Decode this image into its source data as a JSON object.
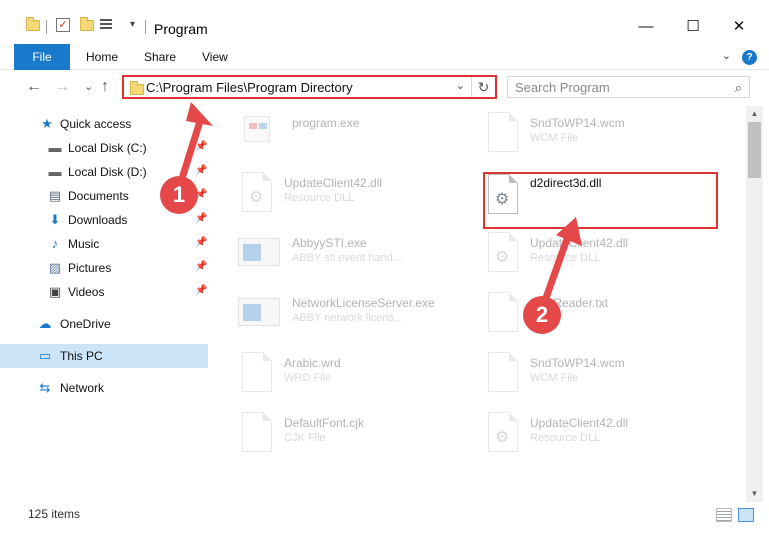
{
  "window": {
    "title": "Program",
    "minimize": "—",
    "maximize": "☐",
    "close": "✕"
  },
  "ribbon": {
    "tabs": [
      {
        "label": "File"
      },
      {
        "label": "Home"
      },
      {
        "label": "Share"
      },
      {
        "label": "View"
      }
    ],
    "help": "?",
    "collapse": "⌄"
  },
  "nav": {
    "back": "←",
    "forward": "→",
    "recent": "⌄",
    "up": "↑"
  },
  "address": {
    "path": "C:\\Program Files\\Program Directory",
    "dropdown": "⌄",
    "refresh": "↻"
  },
  "search": {
    "placeholder": "Search Program",
    "icon": "⌕"
  },
  "sidebar": {
    "items": [
      {
        "label": "Quick access",
        "icon": "★",
        "pinned": false
      },
      {
        "label": "Local Disk (C:)",
        "icon": "▬",
        "pinned": true
      },
      {
        "label": "Local Disk (D:)",
        "icon": "▬",
        "pinned": true
      },
      {
        "label": "Documents",
        "icon": "▤",
        "pinned": true
      },
      {
        "label": "Downloads",
        "icon": "⬇",
        "pinned": true
      },
      {
        "label": "Music",
        "icon": "♪",
        "pinned": true
      },
      {
        "label": "Pictures",
        "icon": "▨",
        "pinned": true
      },
      {
        "label": "Videos",
        "icon": "▣",
        "pinned": true
      },
      {
        "label": "OneDrive",
        "icon": "☁",
        "pinned": false
      },
      {
        "label": "This PC",
        "icon": "▭",
        "pinned": false
      },
      {
        "label": "Network",
        "icon": "⇆",
        "pinned": false
      }
    ]
  },
  "files": [
    {
      "name": "program.exe",
      "type": "",
      "icon": "exe-icon"
    },
    {
      "name": "SndToWP14.wcm",
      "type": "WCM File",
      "icon": "document-icon"
    },
    {
      "name": "UpdateClient42.dll",
      "type": "Resource DLL",
      "icon": "dll-gear-icon"
    },
    {
      "name": "d2direct3d.dll",
      "type": "",
      "icon": "dll-gear-icon"
    },
    {
      "name": "AbbyySTI.exe",
      "type": "ABBY sti event hand...",
      "icon": "window-app-icon"
    },
    {
      "name": "UpdateClient42.dll",
      "type": "Resource DLL",
      "icon": "dll-gear-icon"
    },
    {
      "name": "NetworkLicenseServer.exe",
      "type": "ABBY network licens...",
      "icon": "window-app-icon"
    },
    {
      "name": "FineReader.txt",
      "type": "File",
      "icon": "document-icon"
    },
    {
      "name": "Arabic.wrd",
      "type": "WRD File",
      "icon": "document-icon"
    },
    {
      "name": "SndToWP14.wcm",
      "type": "WCM File",
      "icon": "document-icon"
    },
    {
      "name": "DefaultFont.cjk",
      "type": "CJK File",
      "icon": "document-icon"
    },
    {
      "name": "UpdateClient42.dll",
      "type": "Resource DLL",
      "icon": "dll-gear-icon"
    }
  ],
  "status": {
    "count": "125 items"
  },
  "annotations": {
    "step1": "1",
    "step2": "2"
  },
  "colors": {
    "accent": "#1979ca",
    "highlight": "#dd3333",
    "selected": "#cce4f7"
  }
}
